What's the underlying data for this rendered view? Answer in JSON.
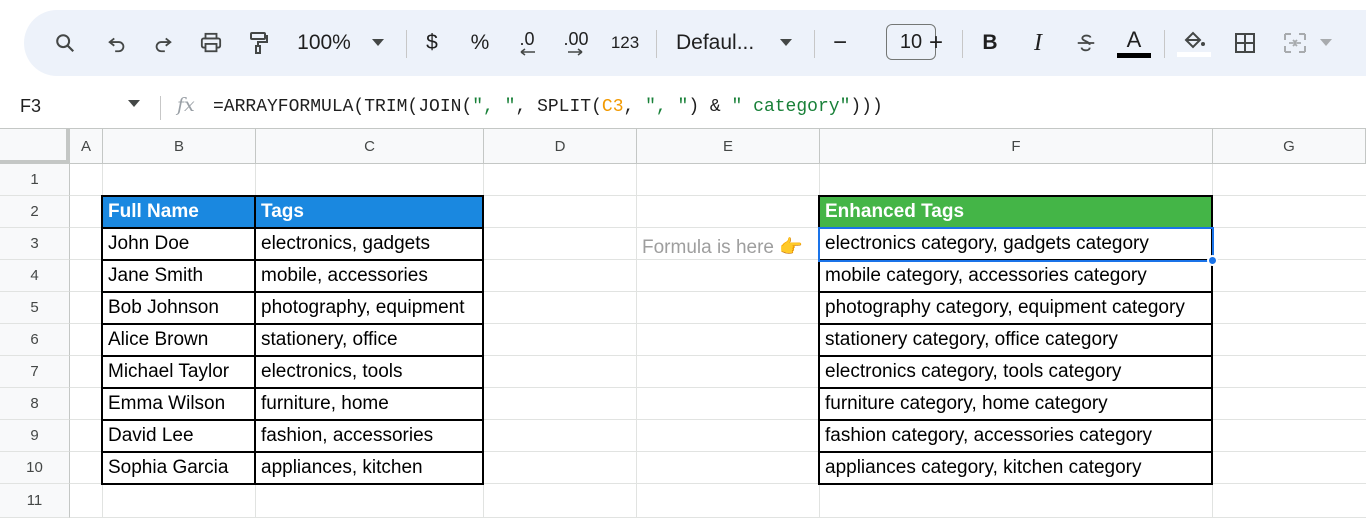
{
  "toolbar": {
    "zoom": "100%",
    "currency": "$",
    "percent": "%",
    "decrease_decimal": ".0",
    "increase_decimal": ".00",
    "number_format": "123",
    "font": "Defaul...",
    "minus": "−",
    "font_size": "10",
    "plus": "+",
    "bold": "B",
    "italic": "I",
    "text_color": "A",
    "text_color_swatch": "#000000",
    "fill_color_swatch": "#ffffff"
  },
  "formula_bar": {
    "name_box": "F3",
    "fx": "fx",
    "formula_parts": [
      "=ARRAYFORMULA(TRIM(JOIN(",
      "\", \"",
      ", SPLIT(",
      "C3",
      ", ",
      "\", \"",
      ") & ",
      "\" category\"",
      ")))"
    ]
  },
  "columns": [
    "A",
    "B",
    "C",
    "D",
    "E",
    "F",
    "G"
  ],
  "rows": [
    "1",
    "2",
    "3",
    "4",
    "5",
    "6",
    "7",
    "8",
    "9",
    "10",
    "11"
  ],
  "table_left": {
    "headers": [
      "Full Name",
      "Tags"
    ],
    "header_color": "#1a88e0",
    "rows": [
      [
        "John Doe",
        "electronics, gadgets"
      ],
      [
        "Jane Smith",
        "mobile, accessories"
      ],
      [
        "Bob Johnson",
        "photography, equipment"
      ],
      [
        "Alice Brown",
        "stationery, office"
      ],
      [
        "Michael Taylor",
        "electronics, tools"
      ],
      [
        "Emma Wilson",
        "furniture, home"
      ],
      [
        "David Lee",
        "fashion, accessories"
      ],
      [
        "Sophia Garcia",
        "appliances, kitchen"
      ]
    ]
  },
  "note": "Formula is here 👉",
  "table_right": {
    "header": "Enhanced Tags",
    "header_color": "#44b547",
    "rows": [
      "electronics category, gadgets category",
      "mobile category, accessories category",
      "photography category, equipment category",
      "stationery category, office category",
      "electronics category, tools category",
      "furniture category, home category",
      "fashion category, accessories category",
      "appliances category, kitchen category"
    ]
  },
  "selection_color": "#1a73e8"
}
